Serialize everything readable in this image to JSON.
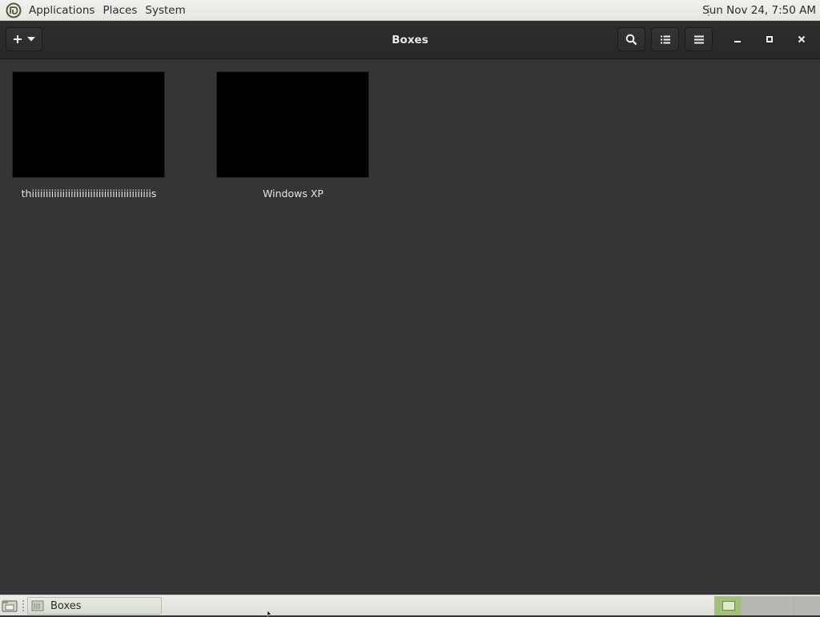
{
  "top_panel": {
    "menus": [
      "Applications",
      "Places",
      "System"
    ],
    "clock": "Sun Nov 24,  7:50 AM"
  },
  "headerbar": {
    "title": "Boxes",
    "icons": {
      "add": "plus-icon",
      "dropdown": "chevron-down-icon",
      "search": "search-icon",
      "list_view": "list-view-icon",
      "menu": "hamburger-menu-icon",
      "minimize": "minimize-icon",
      "maximize": "maximize-icon",
      "close": "close-icon"
    }
  },
  "boxes": [
    {
      "name": "thiiiiiiiiiiiiiiiiiiiiiiiiiiiiiiiiiiiiiiiiiiis",
      "thumbnail_color": "#000000"
    },
    {
      "name": "Windows XP",
      "thumbnail_color": "#000000"
    }
  ],
  "bottom_panel": {
    "task_label": "Boxes",
    "workspaces": 4,
    "active_workspace": 1
  },
  "colors": {
    "background": "#353535",
    "headerbar": "#2b2b2b",
    "panel": "#e8e8e5",
    "active_workspace": "#a3c07a"
  }
}
